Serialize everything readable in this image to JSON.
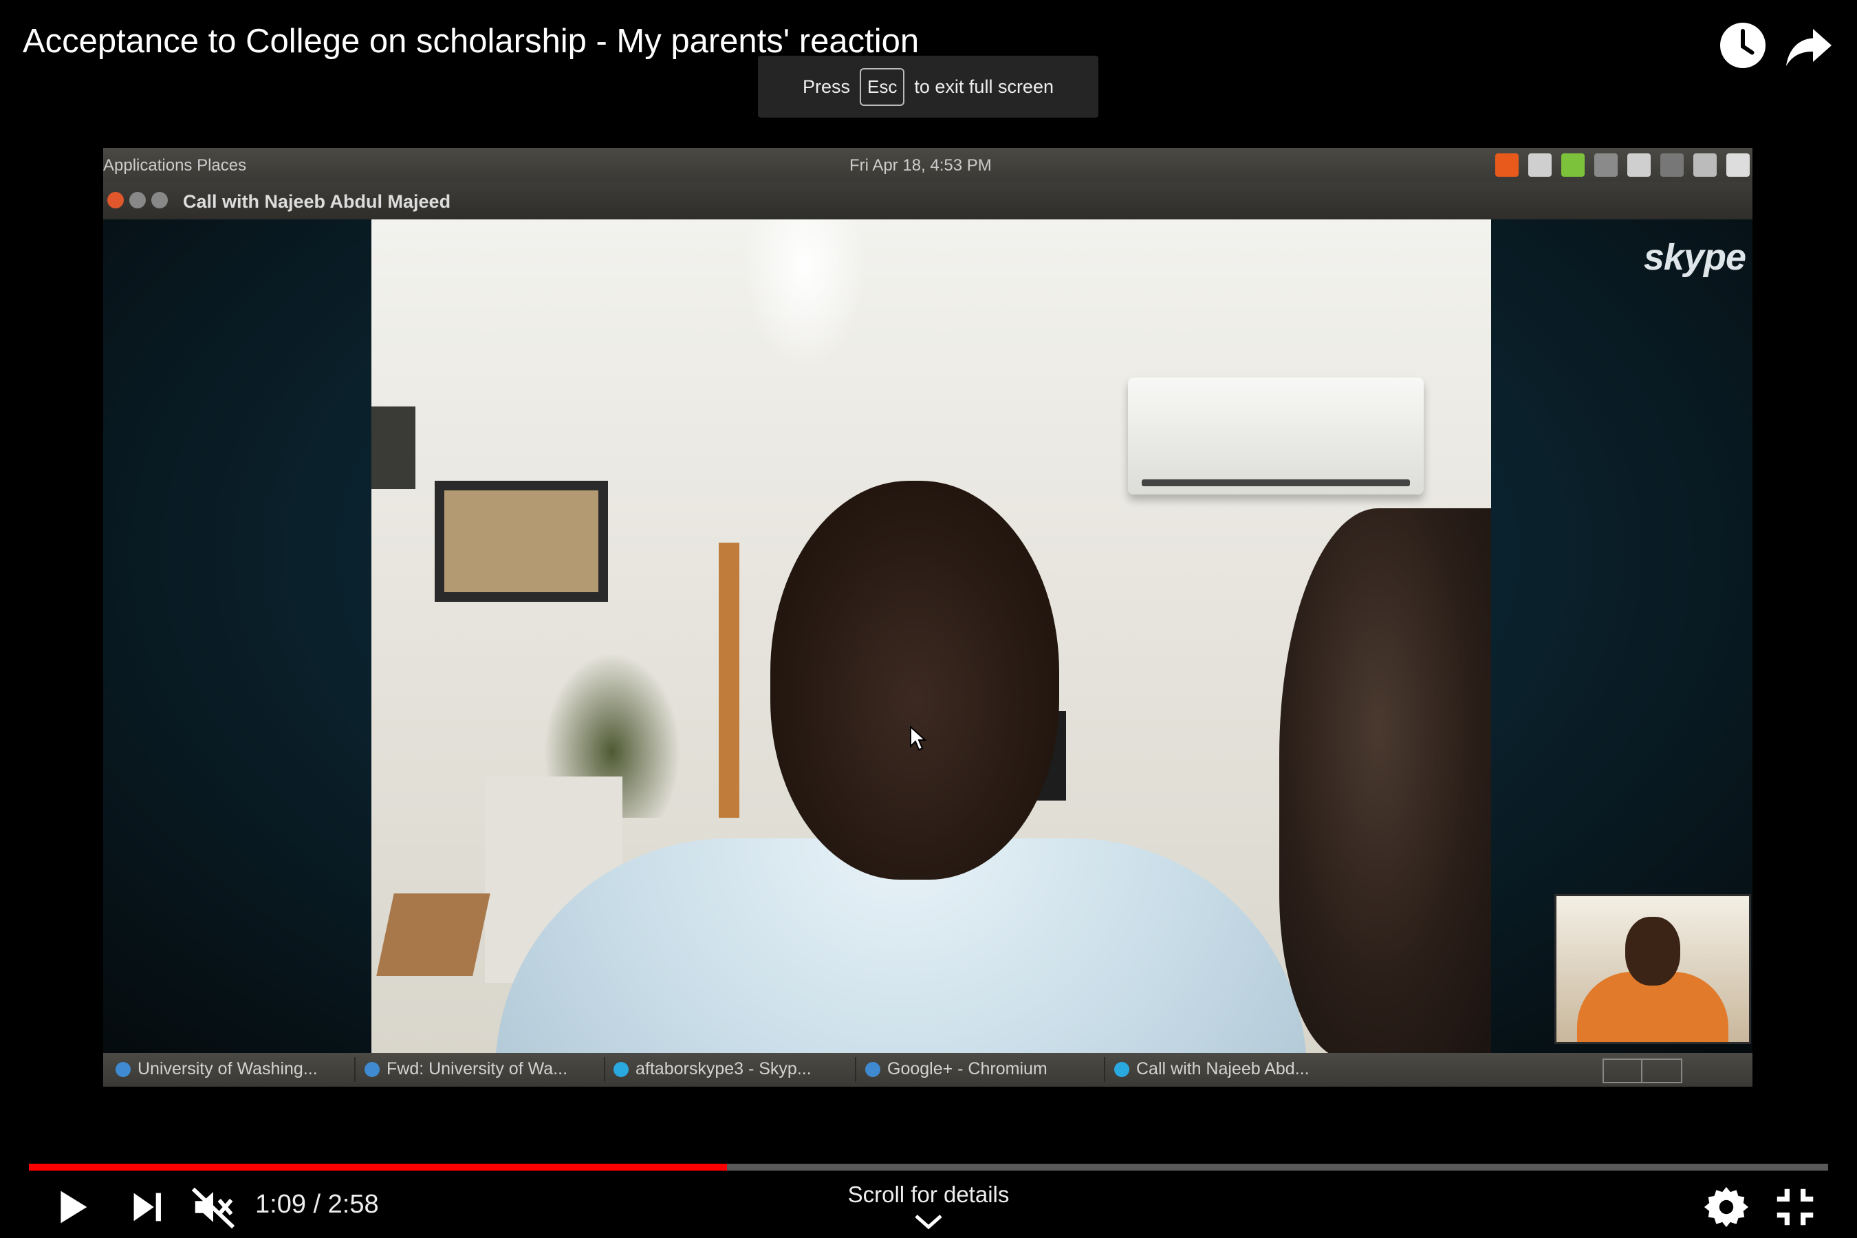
{
  "video_title": "Acceptance to College on scholarship - My parents' reaction",
  "top_actions": {
    "watch_later_icon": "clock-icon",
    "share_icon": "share-arrow-icon"
  },
  "fullscreen_toast": {
    "press": "Press",
    "key": "Esc",
    "suffix": "to exit full screen"
  },
  "video_frame": {
    "panel": {
      "menu": "Applications  Places",
      "clock": "Fri Apr 18, 4:53 PM"
    },
    "window_title": "Call with Najeeb Abdul Majeed",
    "skype_logo": "skype",
    "taskbar_items": [
      "University of Washing...",
      "Fwd: University of Wa...",
      "aftaborskype3 - Skyp...",
      "Google+ - Chromium",
      "Call with Najeeb Abd..."
    ]
  },
  "player": {
    "current_time": "1:09",
    "duration": "2:58",
    "time_display": "1:09 / 2:58",
    "progress_fraction": 0.388,
    "scroll_hint": "Scroll for details",
    "colors": {
      "progress_played": "#ff0000",
      "progress_track": "#888888"
    }
  }
}
